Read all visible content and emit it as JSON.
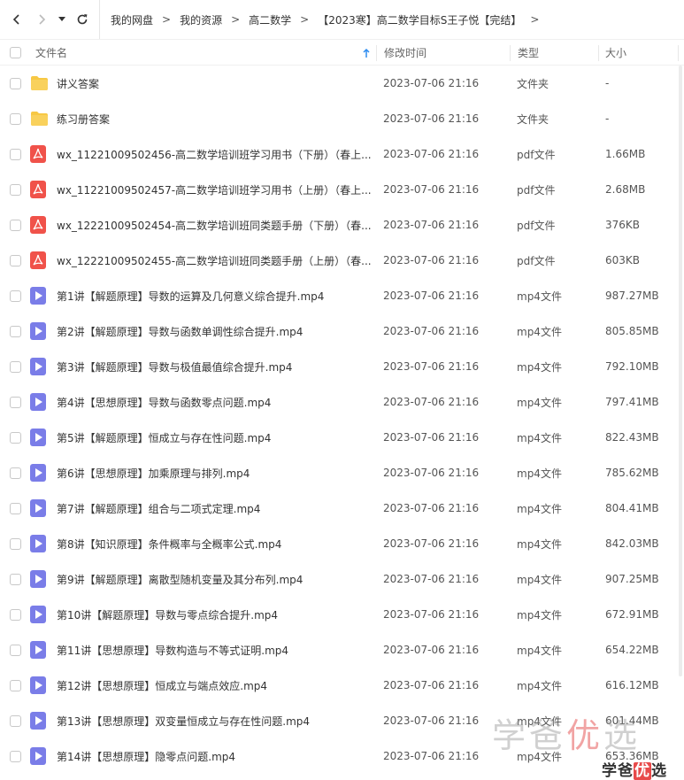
{
  "breadcrumb": [
    "我的网盘",
    "我的资源",
    "高二数学",
    "【2023寒】高二数学目标S王子悦【完结】"
  ],
  "columns": {
    "name": "文件名",
    "modified": "修改时间",
    "type": "类型",
    "size": "大小"
  },
  "files": [
    {
      "name": "讲义答案",
      "time": "2023-07-06 21:16",
      "type": "文件夹",
      "size": "-",
      "icon": "folder-icon"
    },
    {
      "name": "练习册答案",
      "time": "2023-07-06 21:16",
      "type": "文件夹",
      "size": "-",
      "icon": "folder-icon"
    },
    {
      "name": "wx_11221009502456-高二数学培训班学习用书（下册）（春上...",
      "time": "2023-07-06 21:16",
      "type": "pdf文件",
      "size": "1.66MB",
      "icon": "pdf-icon"
    },
    {
      "name": "wx_11221009502457-高二数学培训班学习用书（上册）（春上...",
      "time": "2023-07-06 21:16",
      "type": "pdf文件",
      "size": "2.68MB",
      "icon": "pdf-icon"
    },
    {
      "name": "wx_12221009502454-高二数学培训班同类题手册（下册）（春...",
      "time": "2023-07-06 21:16",
      "type": "pdf文件",
      "size": "376KB",
      "icon": "pdf-icon"
    },
    {
      "name": "wx_12221009502455-高二数学培训班同类题手册（上册）（春...",
      "time": "2023-07-06 21:16",
      "type": "pdf文件",
      "size": "603KB",
      "icon": "pdf-icon"
    },
    {
      "name": "第1讲【解题原理】导数的运算及几何意义综合提升.mp4",
      "time": "2023-07-06 21:16",
      "type": "mp4文件",
      "size": "987.27MB",
      "icon": "video-icon"
    },
    {
      "name": "第2讲【解题原理】导数与函数单调性综合提升.mp4",
      "time": "2023-07-06 21:16",
      "type": "mp4文件",
      "size": "805.85MB",
      "icon": "video-icon"
    },
    {
      "name": "第3讲【解题原理】导数与极值最值综合提升.mp4",
      "time": "2023-07-06 21:16",
      "type": "mp4文件",
      "size": "792.10MB",
      "icon": "video-icon"
    },
    {
      "name": "第4讲【思想原理】导数与函数零点问题.mp4",
      "time": "2023-07-06 21:16",
      "type": "mp4文件",
      "size": "797.41MB",
      "icon": "video-icon"
    },
    {
      "name": "第5讲【解题原理】恒成立与存在性问题.mp4",
      "time": "2023-07-06 21:16",
      "type": "mp4文件",
      "size": "822.43MB",
      "icon": "video-icon"
    },
    {
      "name": "第6讲【思想原理】加乘原理与排列.mp4",
      "time": "2023-07-06 21:16",
      "type": "mp4文件",
      "size": "785.62MB",
      "icon": "video-icon"
    },
    {
      "name": "第7讲【解题原理】组合与二项式定理.mp4",
      "time": "2023-07-06 21:16",
      "type": "mp4文件",
      "size": "804.41MB",
      "icon": "video-icon"
    },
    {
      "name": "第8讲【知识原理】条件概率与全概率公式.mp4",
      "time": "2023-07-06 21:16",
      "type": "mp4文件",
      "size": "842.03MB",
      "icon": "video-icon"
    },
    {
      "name": "第9讲【解题原理】离散型随机变量及其分布列.mp4",
      "time": "2023-07-06 21:16",
      "type": "mp4文件",
      "size": "907.25MB",
      "icon": "video-icon"
    },
    {
      "name": "第10讲【解题原理】导数与零点综合提升.mp4",
      "time": "2023-07-06 21:16",
      "type": "mp4文件",
      "size": "672.91MB",
      "icon": "video-icon"
    },
    {
      "name": "第11讲【思想原理】导数构造与不等式证明.mp4",
      "time": "2023-07-06 21:16",
      "type": "mp4文件",
      "size": "654.22MB",
      "icon": "video-icon"
    },
    {
      "name": "第12讲【思想原理】恒成立与端点效应.mp4",
      "time": "2023-07-06 21:16",
      "type": "mp4文件",
      "size": "616.12MB",
      "icon": "video-icon"
    },
    {
      "name": "第13讲【思想原理】双变量恒成立与存在性问题.mp4",
      "time": "2023-07-06 21:16",
      "type": "mp4文件",
      "size": "601.44MB",
      "icon": "video-icon"
    },
    {
      "name": "第14讲【思想原理】隐零点问题.mp4",
      "time": "2023-07-06 21:16",
      "type": "mp4文件",
      "size": "653.36MB",
      "icon": "video-icon"
    }
  ],
  "watermark": {
    "big_a": "学爸",
    "big_b": "优",
    "big_c": "选",
    "small_a": "学爸",
    "small_b": "优",
    "small_c": "选"
  },
  "colors": {
    "folder": "#f7c844",
    "pdf": "#f0524a",
    "video": "#7a7de8",
    "sort_arrow": "#2d8cf0"
  }
}
